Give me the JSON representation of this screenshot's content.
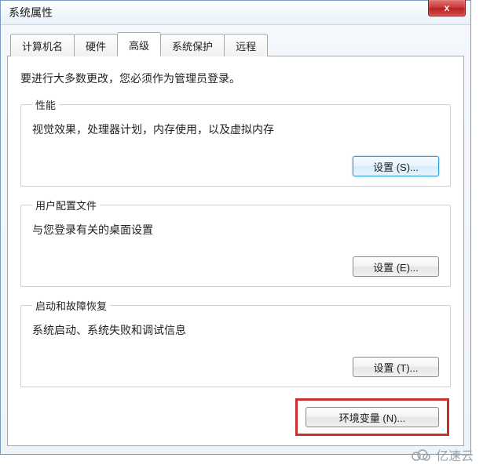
{
  "window": {
    "title": "系统属性",
    "close_label": "x"
  },
  "tabs": {
    "computer_name": "计算机名",
    "hardware": "硬件",
    "advanced": "高级",
    "system_protection": "系统保护",
    "remote": "远程"
  },
  "advanced_panel": {
    "intro": "要进行大多数更改，您必须作为管理员登录。",
    "performance": {
      "legend": "性能",
      "desc": "视觉效果，处理器计划，内存使用，以及虚拟内存",
      "button": "设置 (S)..."
    },
    "user_profiles": {
      "legend": "用户配置文件",
      "desc": "与您登录有关的桌面设置",
      "button": "设置 (E)..."
    },
    "startup_recovery": {
      "legend": "启动和故障恢复",
      "desc": "系统启动、系统失败和调试信息",
      "button": "设置 (T)..."
    },
    "env_vars_button": "环境变量 (N)..."
  },
  "watermark": {
    "text": "亿速云"
  }
}
